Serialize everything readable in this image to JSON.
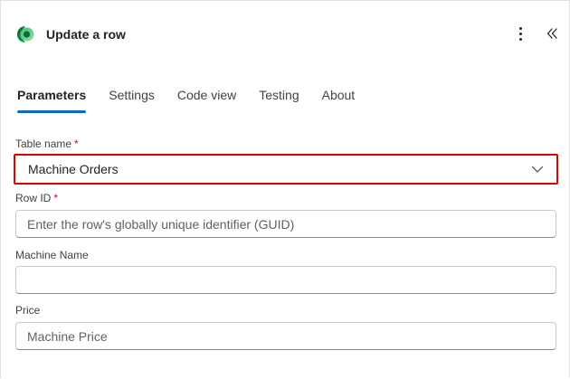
{
  "header": {
    "title": "Update a row",
    "more_icon": "more-vertical-icon",
    "collapse_icon": "double-chevron-left-icon",
    "logo_icon": "dataverse-logo-icon"
  },
  "tabs": [
    {
      "label": "Parameters",
      "active": true
    },
    {
      "label": "Settings",
      "active": false
    },
    {
      "label": "Code view",
      "active": false
    },
    {
      "label": "Testing",
      "active": false
    },
    {
      "label": "About",
      "active": false
    }
  ],
  "form": {
    "table_name": {
      "label": "Table name",
      "required_mark": "*",
      "value": "Machine Orders"
    },
    "row_id": {
      "label": "Row ID",
      "required_mark": "*",
      "value": "",
      "placeholder": "Enter the row's globally unique identifier (GUID)"
    },
    "machine_name": {
      "label": "Machine Name",
      "value": "",
      "placeholder": ""
    },
    "price": {
      "label": "Price",
      "value": "Machine Price"
    }
  },
  "colors": {
    "accent": "#0f6cbd",
    "highlight_border": "#e00000",
    "required": "#c50f1f"
  }
}
